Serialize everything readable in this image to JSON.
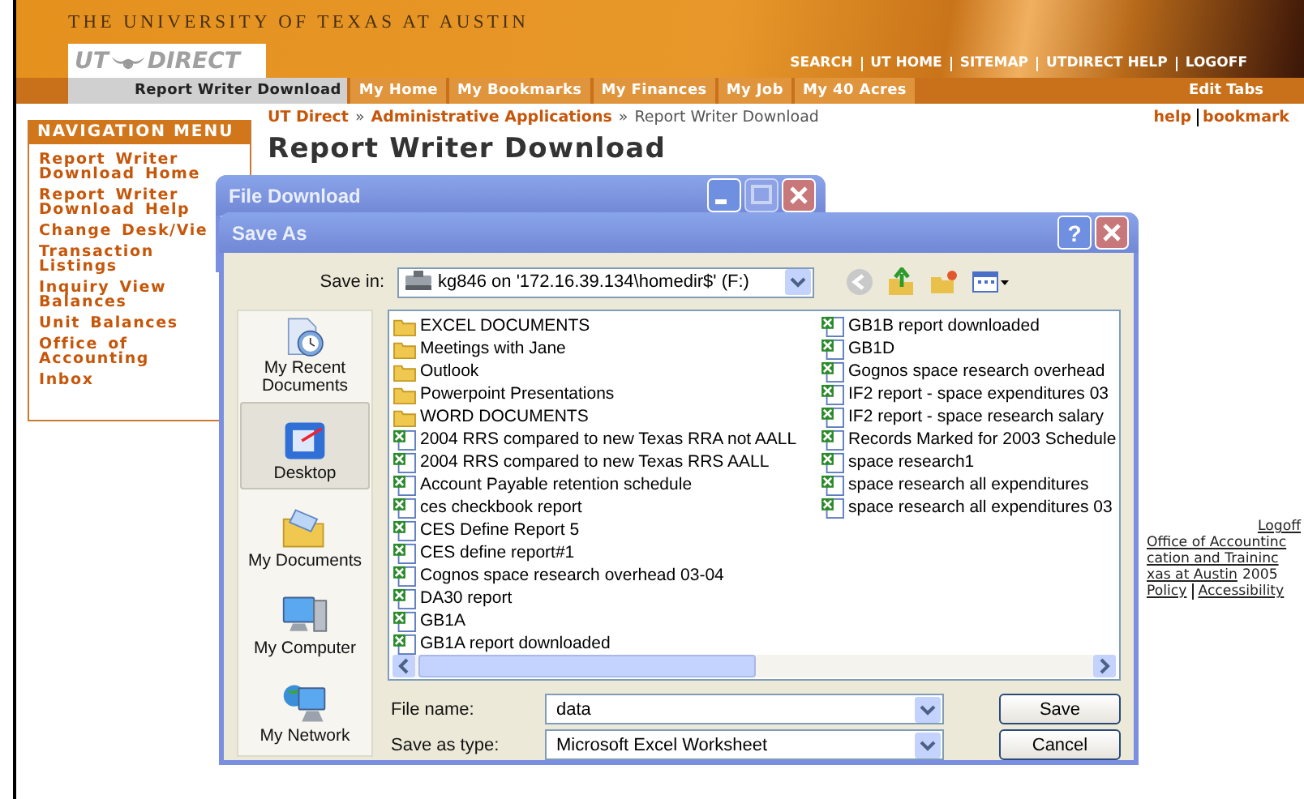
{
  "header": {
    "university": "THE UNIVERSITY OF TEXAS AT AUSTIN",
    "logo_left": "UT",
    "logo_right": "DIRECT",
    "links": [
      "SEARCH",
      "UT HOME",
      "SITEMAP",
      "UTDIRECT HELP",
      "LOGOFF"
    ]
  },
  "tabs": [
    {
      "label": "Report Writer Download",
      "selected": true
    },
    {
      "label": "My Home",
      "selected": false
    },
    {
      "label": "My Bookmarks",
      "selected": false
    },
    {
      "label": "My Finances",
      "selected": false
    },
    {
      "label": "My Job",
      "selected": false
    },
    {
      "label": "My 40 Acres",
      "selected": false
    }
  ],
  "edit_tabs": "Edit Tabs",
  "breadcrumb": [
    {
      "text": "UT Direct",
      "kind": "link"
    },
    {
      "text": "»",
      "kind": "sep"
    },
    {
      "text": "Administrative Applications",
      "kind": "link"
    },
    {
      "text": "»",
      "kind": "sep"
    },
    {
      "text": "Report Writer Download",
      "kind": "current"
    }
  ],
  "page_links": [
    "help",
    "bookmark"
  ],
  "title": "Report Writer Download",
  "navigation": {
    "title": "NAVIGATION MENU",
    "items": [
      "Report Writer Download Home",
      "Report Writer Download Help",
      "Change Desk/Vie",
      "Transaction Listings",
      "Inquiry View Balances",
      "Unit Balances",
      "Office of Accounting",
      "Inbox"
    ]
  },
  "footer": {
    "logoff": "Logoff",
    "lines": [
      "Office of Accountinc",
      "cation and Traininc"
    ],
    "copyright_link": "xas at Austin",
    "copyright_year": "2005",
    "policy_links": [
      "Policy",
      "Accessibility"
    ]
  },
  "file_download": {
    "title": "File Download"
  },
  "save_as": {
    "title": "Save As",
    "help": "?",
    "save_in_label": "Save in:",
    "save_in": "kg846 on '172.16.39.134\\homedir$' (F:)",
    "places": [
      {
        "label": "My Recent Documents",
        "kind": "recent",
        "selected": false
      },
      {
        "label": "Desktop",
        "kind": "desktop",
        "selected": true
      },
      {
        "label": "My Documents",
        "kind": "documents",
        "selected": false
      },
      {
        "label": "My Computer",
        "kind": "computer",
        "selected": false
      },
      {
        "label": "My Network",
        "kind": "network",
        "selected": false
      }
    ],
    "files": [
      {
        "name": "EXCEL DOCUMENTS",
        "kind": "folder"
      },
      {
        "name": "Meetings with Jane",
        "kind": "folder"
      },
      {
        "name": "Outlook",
        "kind": "folder"
      },
      {
        "name": "Powerpoint Presentations",
        "kind": "folder"
      },
      {
        "name": "WORD DOCUMENTS",
        "kind": "folder"
      },
      {
        "name": "2004 RRS compared to new Texas RRA not AALL",
        "kind": "excel"
      },
      {
        "name": "2004 RRS compared to new Texas RRS AALL",
        "kind": "excel"
      },
      {
        "name": "Account Payable retention schedule",
        "kind": "excel"
      },
      {
        "name": "ces checkbook report",
        "kind": "excel"
      },
      {
        "name": "CES Define Report 5",
        "kind": "excel"
      },
      {
        "name": "CES define report#1",
        "kind": "excel"
      },
      {
        "name": "Cognos space research overhead 03-04",
        "kind": "excel"
      },
      {
        "name": "DA30 report",
        "kind": "excel"
      },
      {
        "name": "GB1A",
        "kind": "excel"
      },
      {
        "name": "GB1A report downloaded",
        "kind": "excel"
      },
      {
        "name": "GB1B report downloaded",
        "kind": "excel"
      },
      {
        "name": "GB1D",
        "kind": "excel"
      },
      {
        "name": "Gognos space research overhead",
        "kind": "excel"
      },
      {
        "name": "IF2 report - space expenditures 03",
        "kind": "excel"
      },
      {
        "name": "IF2 report - space research salary",
        "kind": "excel"
      },
      {
        "name": "Records Marked for 2003 Schedule",
        "kind": "excel"
      },
      {
        "name": "space research1",
        "kind": "excel"
      },
      {
        "name": "space research all expenditures",
        "kind": "excel"
      },
      {
        "name": "space research all expenditures 03",
        "kind": "excel"
      }
    ],
    "file_name_label": "File name:",
    "file_name": "data",
    "type_label": "Save as type:",
    "type": "Microsoft Excel Worksheet",
    "buttons": [
      "Save",
      "Cancel"
    ]
  }
}
